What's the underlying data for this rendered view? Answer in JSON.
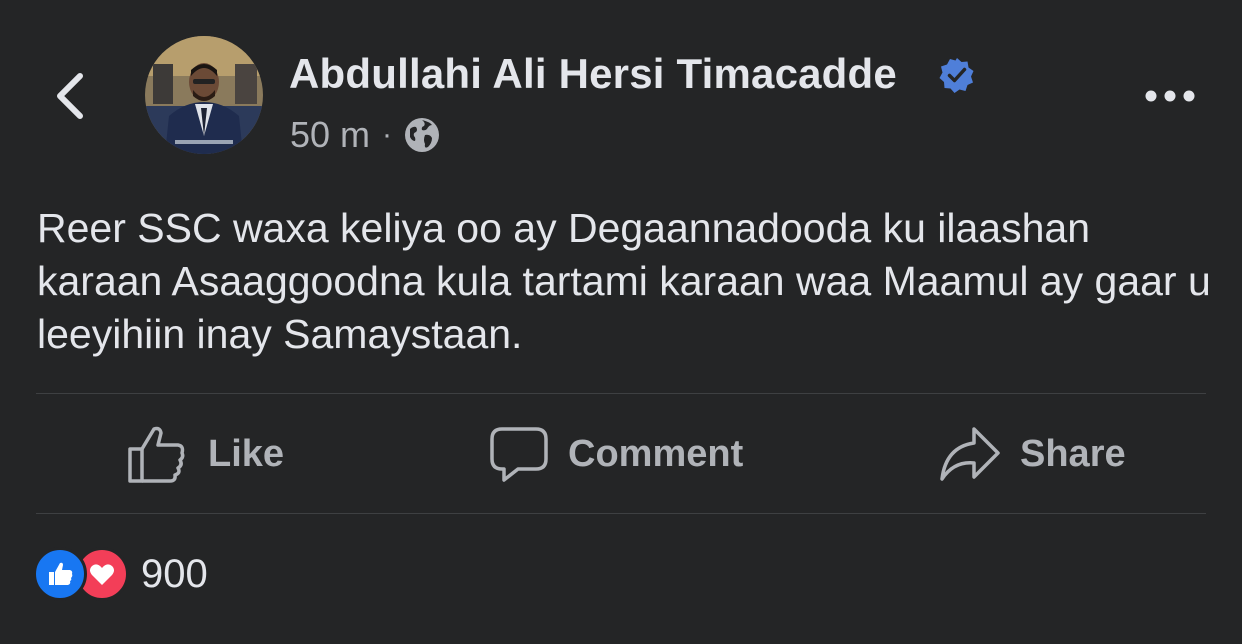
{
  "post": {
    "author": "Abdullahi Ali Hersi Timacadde",
    "timestamp": "50 m",
    "separator": "·",
    "text": "Reer SSC waxa keliya oo ay Degaannadooda ku ilaashan karaan Asaaggoodna kula tartami karaan waa Maamul ay gaar u leeyihiin inay Samaystaan."
  },
  "actions": {
    "like_label": "Like",
    "comment_label": "Comment",
    "share_label": "Share"
  },
  "reactions": {
    "count": "900",
    "types": [
      "like",
      "love"
    ]
  },
  "icons": {
    "back": "chevron-left-icon",
    "verified": "verified-badge-icon",
    "privacy": "globe-icon",
    "more": "more-dots-icon"
  },
  "colors": {
    "background": "#242526",
    "primary_text": "#e4e6eb",
    "secondary_text": "#b0b3b8",
    "accent_blue": "#1877f2",
    "love_red": "#f33e58",
    "divider": "#3e4042"
  }
}
